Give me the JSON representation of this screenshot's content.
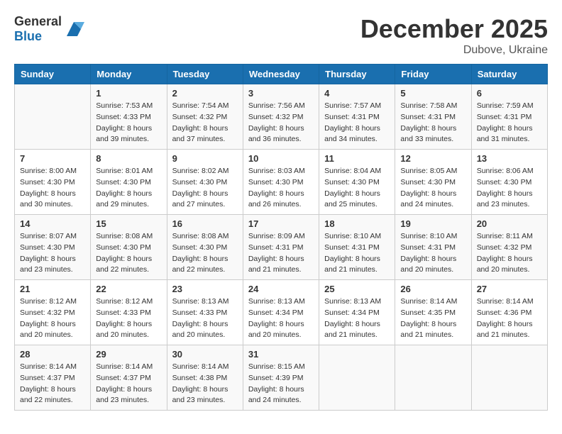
{
  "header": {
    "logo_general": "General",
    "logo_blue": "Blue",
    "month": "December 2025",
    "location": "Dubove, Ukraine"
  },
  "weekdays": [
    "Sunday",
    "Monday",
    "Tuesday",
    "Wednesday",
    "Thursday",
    "Friday",
    "Saturday"
  ],
  "weeks": [
    [
      {
        "day": "",
        "info": ""
      },
      {
        "day": "1",
        "info": "Sunrise: 7:53 AM\nSunset: 4:33 PM\nDaylight: 8 hours\nand 39 minutes."
      },
      {
        "day": "2",
        "info": "Sunrise: 7:54 AM\nSunset: 4:32 PM\nDaylight: 8 hours\nand 37 minutes."
      },
      {
        "day": "3",
        "info": "Sunrise: 7:56 AM\nSunset: 4:32 PM\nDaylight: 8 hours\nand 36 minutes."
      },
      {
        "day": "4",
        "info": "Sunrise: 7:57 AM\nSunset: 4:31 PM\nDaylight: 8 hours\nand 34 minutes."
      },
      {
        "day": "5",
        "info": "Sunrise: 7:58 AM\nSunset: 4:31 PM\nDaylight: 8 hours\nand 33 minutes."
      },
      {
        "day": "6",
        "info": "Sunrise: 7:59 AM\nSunset: 4:31 PM\nDaylight: 8 hours\nand 31 minutes."
      }
    ],
    [
      {
        "day": "7",
        "info": "Sunrise: 8:00 AM\nSunset: 4:30 PM\nDaylight: 8 hours\nand 30 minutes."
      },
      {
        "day": "8",
        "info": "Sunrise: 8:01 AM\nSunset: 4:30 PM\nDaylight: 8 hours\nand 29 minutes."
      },
      {
        "day": "9",
        "info": "Sunrise: 8:02 AM\nSunset: 4:30 PM\nDaylight: 8 hours\nand 27 minutes."
      },
      {
        "day": "10",
        "info": "Sunrise: 8:03 AM\nSunset: 4:30 PM\nDaylight: 8 hours\nand 26 minutes."
      },
      {
        "day": "11",
        "info": "Sunrise: 8:04 AM\nSunset: 4:30 PM\nDaylight: 8 hours\nand 25 minutes."
      },
      {
        "day": "12",
        "info": "Sunrise: 8:05 AM\nSunset: 4:30 PM\nDaylight: 8 hours\nand 24 minutes."
      },
      {
        "day": "13",
        "info": "Sunrise: 8:06 AM\nSunset: 4:30 PM\nDaylight: 8 hours\nand 23 minutes."
      }
    ],
    [
      {
        "day": "14",
        "info": "Sunrise: 8:07 AM\nSunset: 4:30 PM\nDaylight: 8 hours\nand 23 minutes."
      },
      {
        "day": "15",
        "info": "Sunrise: 8:08 AM\nSunset: 4:30 PM\nDaylight: 8 hours\nand 22 minutes."
      },
      {
        "day": "16",
        "info": "Sunrise: 8:08 AM\nSunset: 4:30 PM\nDaylight: 8 hours\nand 22 minutes."
      },
      {
        "day": "17",
        "info": "Sunrise: 8:09 AM\nSunset: 4:31 PM\nDaylight: 8 hours\nand 21 minutes."
      },
      {
        "day": "18",
        "info": "Sunrise: 8:10 AM\nSunset: 4:31 PM\nDaylight: 8 hours\nand 21 minutes."
      },
      {
        "day": "19",
        "info": "Sunrise: 8:10 AM\nSunset: 4:31 PM\nDaylight: 8 hours\nand 20 minutes."
      },
      {
        "day": "20",
        "info": "Sunrise: 8:11 AM\nSunset: 4:32 PM\nDaylight: 8 hours\nand 20 minutes."
      }
    ],
    [
      {
        "day": "21",
        "info": "Sunrise: 8:12 AM\nSunset: 4:32 PM\nDaylight: 8 hours\nand 20 minutes."
      },
      {
        "day": "22",
        "info": "Sunrise: 8:12 AM\nSunset: 4:33 PM\nDaylight: 8 hours\nand 20 minutes."
      },
      {
        "day": "23",
        "info": "Sunrise: 8:13 AM\nSunset: 4:33 PM\nDaylight: 8 hours\nand 20 minutes."
      },
      {
        "day": "24",
        "info": "Sunrise: 8:13 AM\nSunset: 4:34 PM\nDaylight: 8 hours\nand 20 minutes."
      },
      {
        "day": "25",
        "info": "Sunrise: 8:13 AM\nSunset: 4:34 PM\nDaylight: 8 hours\nand 21 minutes."
      },
      {
        "day": "26",
        "info": "Sunrise: 8:14 AM\nSunset: 4:35 PM\nDaylight: 8 hours\nand 21 minutes."
      },
      {
        "day": "27",
        "info": "Sunrise: 8:14 AM\nSunset: 4:36 PM\nDaylight: 8 hours\nand 21 minutes."
      }
    ],
    [
      {
        "day": "28",
        "info": "Sunrise: 8:14 AM\nSunset: 4:37 PM\nDaylight: 8 hours\nand 22 minutes."
      },
      {
        "day": "29",
        "info": "Sunrise: 8:14 AM\nSunset: 4:37 PM\nDaylight: 8 hours\nand 23 minutes."
      },
      {
        "day": "30",
        "info": "Sunrise: 8:14 AM\nSunset: 4:38 PM\nDaylight: 8 hours\nand 23 minutes."
      },
      {
        "day": "31",
        "info": "Sunrise: 8:15 AM\nSunset: 4:39 PM\nDaylight: 8 hours\nand 24 minutes."
      },
      {
        "day": "",
        "info": ""
      },
      {
        "day": "",
        "info": ""
      },
      {
        "day": "",
        "info": ""
      }
    ]
  ]
}
